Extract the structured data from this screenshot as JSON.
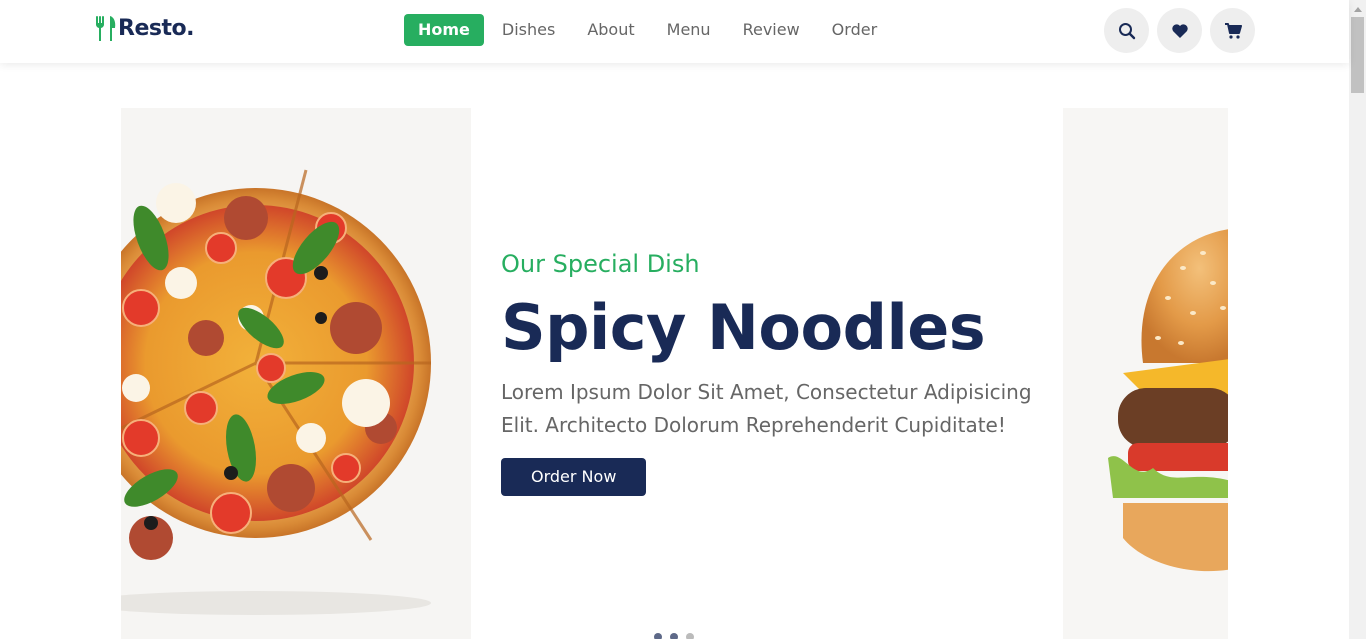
{
  "header": {
    "logo_text": "Resto.",
    "nav": [
      {
        "label": "Home",
        "active": true
      },
      {
        "label": "Dishes",
        "active": false
      },
      {
        "label": "About",
        "active": false
      },
      {
        "label": "Menu",
        "active": false
      },
      {
        "label": "Review",
        "active": false
      },
      {
        "label": "Order",
        "active": false
      }
    ],
    "icons": [
      "search-icon",
      "heart-icon",
      "cart-icon"
    ]
  },
  "hero": {
    "subtitle": "Our Special Dish",
    "title": "Spicy Noodles",
    "description": "Lorem Ipsum Dolor Sit Amet, Consectetur Adipisicing Elit. Architecto Dolorum Reprehenderit Cupiditate!",
    "button_label": "Order Now",
    "slide_count": 3,
    "active_slide": 1
  },
  "colors": {
    "accent": "#27ae60",
    "primary": "#192a56",
    "text_muted": "#666666"
  }
}
